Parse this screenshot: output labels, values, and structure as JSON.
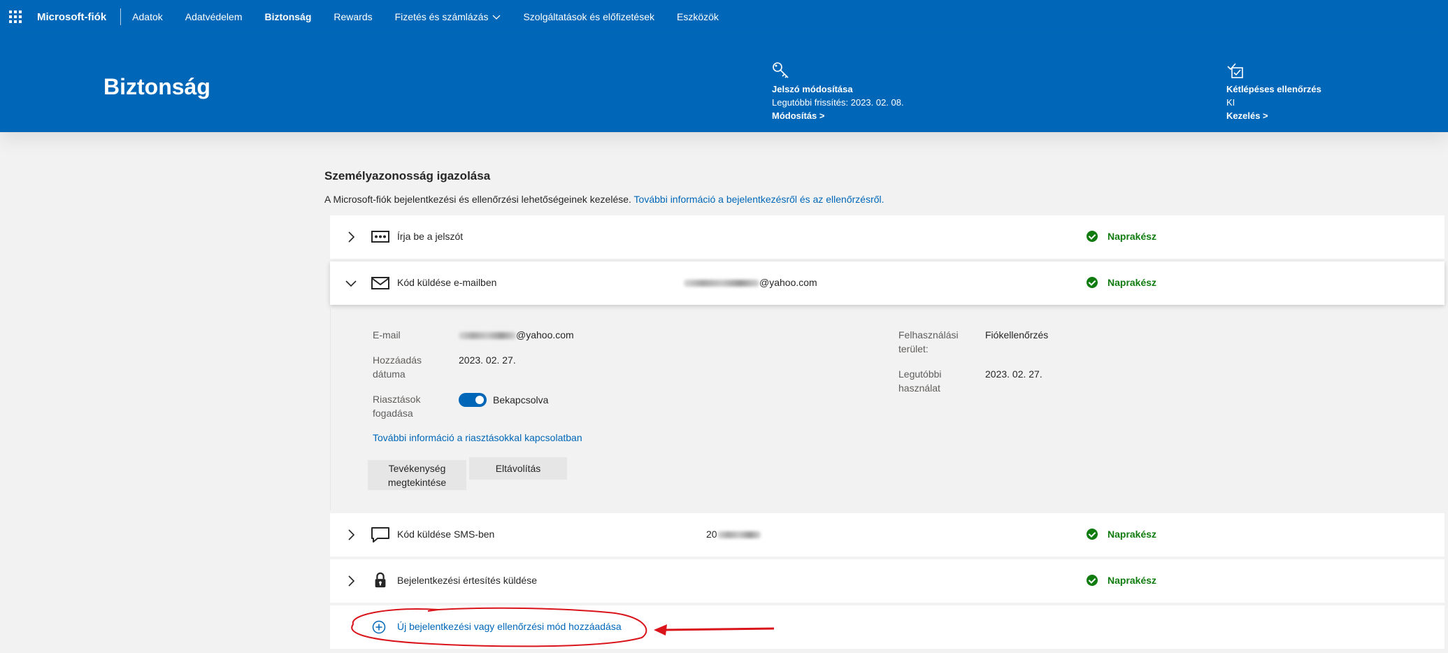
{
  "topnav": {
    "brand": "Microsoft-fiók",
    "items": [
      {
        "label": "Adatok"
      },
      {
        "label": "Adatvédelem"
      },
      {
        "label": "Biztonság"
      },
      {
        "label": "Rewards"
      },
      {
        "label": "Fizetés és számlázás"
      },
      {
        "label": "Szolgáltatások és előfizetések"
      },
      {
        "label": "Eszközök"
      }
    ]
  },
  "banner": {
    "title": "Biztonság",
    "password_card": {
      "icon": "key-icon",
      "title": "Jelszó módosítása",
      "subtitle": "Legutóbbi frissítés: 2023. 02. 08.",
      "link": "Módosítás >"
    },
    "twostep_card": {
      "icon": "verified-checklist-icon",
      "title": "Kétlépéses ellenőrzés",
      "subtitle": "KI",
      "link": "Kezelés >"
    }
  },
  "section": {
    "title": "Személyazonosság igazolása",
    "description": "A Microsoft-fiók bejelentkezési és ellenőrzési lehetőségeinek kezelése. ",
    "description_link": "További információ a bejelentkezésről és az ellenőrzésről."
  },
  "methods": [
    {
      "label": "Írja be a jelszót",
      "value": "",
      "status": "Naprakész",
      "icon": "password-dots-icon"
    },
    {
      "label": "Kód küldése e-mailben",
      "value": "@yahoo.com",
      "status": "Naprakész",
      "icon": "mail-icon"
    },
    {
      "label": "Kód küldése SMS-ben",
      "value": "20",
      "status": "Naprakész",
      "icon": "chat-icon"
    },
    {
      "label": "Bejelentkezési értesítés küldése",
      "value": "",
      "status": "Naprakész",
      "icon": "lock-icon"
    }
  ],
  "email_details": {
    "email_label": "E-mail",
    "email_value": "@yahoo.com",
    "added_label": "Hozzáadás dátuma",
    "added_value": "2023. 02. 27.",
    "alerts_label": "Riasztások fogadása",
    "alerts_value": "Bekapcsolva",
    "alerts_on": true,
    "alerts_link": "További információ a riasztásokkal kapcsolatban",
    "usage_label": "Felhasználási terület:",
    "usage_value": "Fiókellenőrzés",
    "last_used_label": "Legutóbbi használat",
    "last_used_value": "2023. 02. 27.",
    "view_activity_button": "Tevékenység megtekintése",
    "remove_button": "Eltávolítás"
  },
  "add_method": {
    "label": "Új bejelentkezési vagy ellenőrzési mód hozzáadása"
  },
  "colors": {
    "brand_blue": "#0067b8",
    "status_green": "#107c10",
    "annotation_red": "#d9141b"
  }
}
